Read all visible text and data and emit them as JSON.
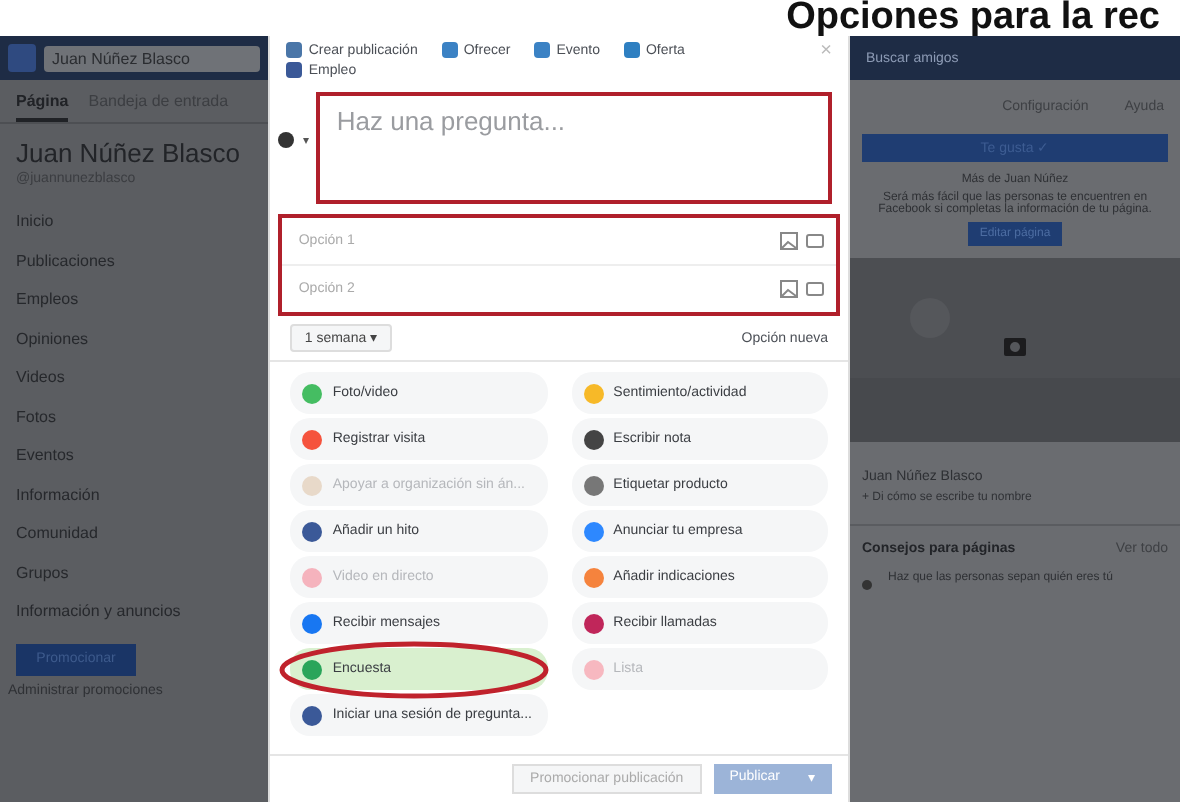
{
  "heading": "Opciones para la rec",
  "left": {
    "search": "Juan Núñez Blasco",
    "tabs": [
      {
        "label": "Página",
        "selected": true
      },
      {
        "label": "Bandeja de entrada",
        "selected": false
      }
    ],
    "name": "Juan Núñez Blasco",
    "handle": "@juannunezblasco",
    "nav": [
      "Inicio",
      "Publicaciones",
      "Empleos",
      "Opiniones",
      "Videos",
      "Fotos",
      "Eventos",
      "Información",
      "Comunidad",
      "Grupos",
      "Información y anuncios"
    ],
    "promote": "Promocionar",
    "manage": "Administrar promociones"
  },
  "composer": {
    "tabs": [
      {
        "label": "Crear publicación",
        "color": "#4a76a8"
      },
      {
        "label": "Ofrecer",
        "color": "#3b82c4"
      },
      {
        "label": "Evento",
        "color": "#3b82c4"
      },
      {
        "label": "Oferta",
        "color": "#2e7fc1"
      },
      {
        "label": "Empleo",
        "color": "#3b5998"
      }
    ],
    "close": "×",
    "audience_caret": "▾",
    "question": {
      "placeholder": "Haz una pregunta..."
    },
    "choices": [
      {
        "placeholder": "Opción 1"
      },
      {
        "placeholder": "Opción 2"
      }
    ],
    "duration": "1 semana ▾",
    "add": "Opción nueva",
    "actions": [
      {
        "label": "Foto/video",
        "color": "#45bd62",
        "disabled": false,
        "selected": false
      },
      {
        "label": "Sentimiento/actividad",
        "color": "#f7b928",
        "disabled": false,
        "selected": false
      },
      {
        "label": "Registrar visita",
        "color": "#f5533d",
        "disabled": false,
        "selected": false
      },
      {
        "label": "Escribir nota",
        "color": "#444444",
        "disabled": false,
        "selected": false
      },
      {
        "label": "Apoyar a organización sin án...",
        "color": "#e8d9c9",
        "disabled": true,
        "selected": false
      },
      {
        "label": "Etiquetar producto",
        "color": "#777777",
        "disabled": false,
        "selected": false
      },
      {
        "label": "Añadir un hito",
        "color": "#3b5998",
        "disabled": false,
        "selected": false
      },
      {
        "label": "Anunciar tu empresa",
        "color": "#2d88ff",
        "disabled": false,
        "selected": false
      },
      {
        "label": "Video en directo",
        "color": "#f5b3bd",
        "disabled": true,
        "selected": false
      },
      {
        "label": "Añadir indicaciones",
        "color": "#f5833d",
        "disabled": false,
        "selected": false
      },
      {
        "label": "Recibir mensajes",
        "color": "#1877f2",
        "disabled": false,
        "selected": false
      },
      {
        "label": "Recibir llamadas",
        "color": "#c0265a",
        "disabled": false,
        "selected": false
      },
      {
        "label": "Encuesta",
        "color": "#2aa55a",
        "disabled": false,
        "selected": true
      },
      {
        "label": "Lista",
        "color": "#f7b8c0",
        "disabled": true,
        "selected": false
      },
      {
        "label": "Iniciar una sesión de pregunta...",
        "color": "#3b5998",
        "disabled": false,
        "selected": false
      }
    ],
    "boost": "Promocionar publicación",
    "publish": "Publicar",
    "publish_caret": "▾"
  },
  "right": {
    "search": "Buscar amigos",
    "links": [
      "Configuración",
      "Ayuda"
    ],
    "liked": "Te gusta ✓",
    "info_title": "Más de Juan Núñez",
    "info": "Será más fácil que las personas te encuentren en Facebook si completas la información de tu página.",
    "info_button": "Editar página",
    "profile": "Juan Núñez Blasco",
    "hint": "+ Di cómo se escribe tu nombre",
    "tips_title": "Consejos para páginas",
    "tips_link": "Ver todo",
    "tip": "Haz que las personas sepan quién eres tú"
  }
}
